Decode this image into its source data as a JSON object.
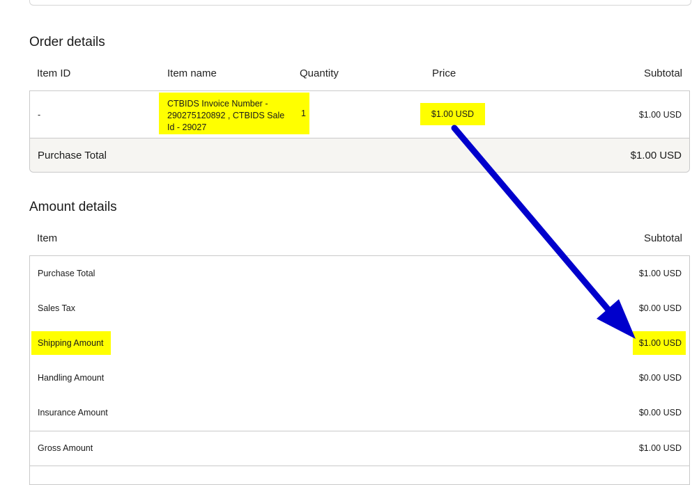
{
  "order": {
    "title": "Order details",
    "headers": {
      "item_id": "Item ID",
      "item_name": "Item name",
      "quantity": "Quantity",
      "price": "Price",
      "subtotal": "Subtotal"
    },
    "row": {
      "item_id": "-",
      "item_name_lines": [
        "CTBIDS Invoice Number -",
        "290275120892 , CTBIDS Sale",
        "Id - 29027"
      ],
      "quantity": "1",
      "price": "$1.00 USD",
      "subtotal": "$1.00 USD"
    },
    "footer": {
      "label": "Purchase Total",
      "value": "$1.00 USD"
    }
  },
  "amount": {
    "title": "Amount details",
    "headers": {
      "item": "Item",
      "subtotal": "Subtotal"
    },
    "rows": [
      {
        "label": "Purchase Total",
        "value": "$1.00 USD"
      },
      {
        "label": "Sales Tax",
        "value": "$0.00 USD"
      },
      {
        "label": "Shipping Amount",
        "value": "$1.00 USD"
      },
      {
        "label": "Handling Amount",
        "value": "$0.00 USD"
      },
      {
        "label": "Insurance Amount",
        "value": "$0.00 USD"
      },
      {
        "label": "Gross Amount",
        "value": "$1.00 USD"
      }
    ]
  },
  "colors": {
    "highlight": "#ffff00",
    "arrow": "#0000cc",
    "border": "#c9c9c9",
    "footer_bg": "#f6f5f2"
  }
}
